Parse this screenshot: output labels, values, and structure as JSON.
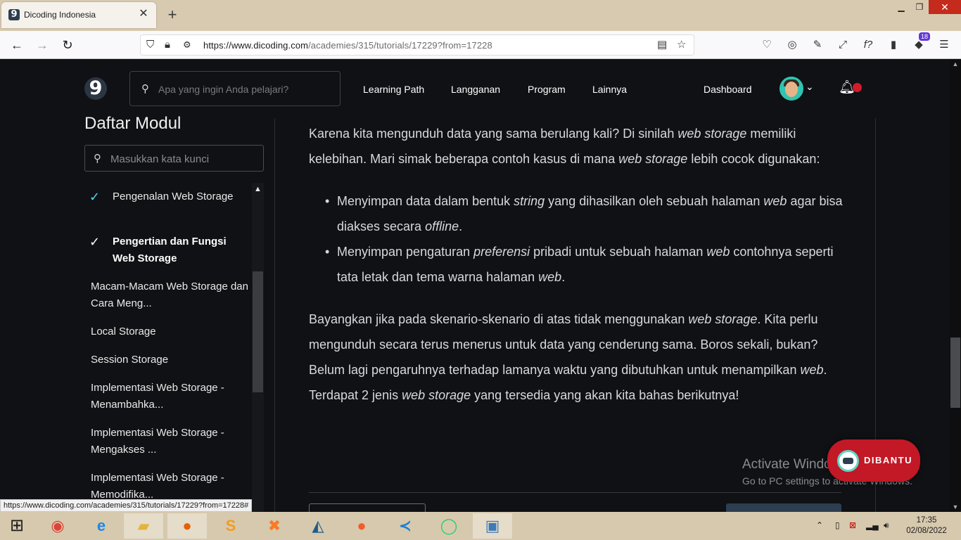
{
  "browser": {
    "tab_title": "Dicoding Indonesia",
    "tab_favicon": "9",
    "url_host": "https://www.dicoding.com",
    "url_path": "/academies/315/tutorials/17229?from=17228",
    "extension_badge": "18",
    "status_url": "https://www.dicoding.com/academies/315/tutorials/17229?from=17228#"
  },
  "header": {
    "logo_char": "9",
    "search_placeholder": "Apa yang ingin Anda pelajari?",
    "nav": [
      "Learning Path",
      "Langganan",
      "Program",
      "Lainnya"
    ],
    "dashboard": "Dashboard"
  },
  "sidebar": {
    "title": "Daftar Modul",
    "search_placeholder": "Masukkan kata kunci",
    "items": [
      {
        "label": "Pengenalan Web Storage",
        "state": "done"
      },
      {
        "label": "Pengertian dan Fungsi Web Storage",
        "state": "active"
      },
      {
        "label": "Macam-Macam Web Storage dan Cara Meng...",
        "state": "plain"
      },
      {
        "label": "Local Storage",
        "state": "plain"
      },
      {
        "label": "Session Storage",
        "state": "plain"
      },
      {
        "label": "Implementasi Web Storage - Menambahka...",
        "state": "plain"
      },
      {
        "label": "Implementasi Web Storage - Mengakses ...",
        "state": "plain"
      },
      {
        "label": "Implementasi Web Storage - Memodifika...",
        "state": "plain"
      }
    ]
  },
  "content": {
    "p1": [
      {
        "t": "Karena kita mengunduh data yang sama berulang kali? Di sinilah "
      },
      {
        "t": "web storage",
        "i": true
      },
      {
        "t": " memiliki kelebihan. Mari simak beberapa contoh kasus di mana "
      },
      {
        "t": "web storage",
        "i": true
      },
      {
        "t": " lebih cocok digunakan:"
      }
    ],
    "bullets": [
      [
        {
          "t": "Menyimpan data dalam bentuk "
        },
        {
          "t": "string",
          "i": true
        },
        {
          "t": " yang dihasilkan oleh sebuah halaman "
        },
        {
          "t": "web",
          "i": true
        },
        {
          "t": " agar bisa diakses secara "
        },
        {
          "t": "offline",
          "i": true
        },
        {
          "t": "."
        }
      ],
      [
        {
          "t": "Menyimpan pengaturan "
        },
        {
          "t": "preferensi",
          "i": true
        },
        {
          "t": " pribadi untuk sebuah halaman "
        },
        {
          "t": "web",
          "i": true
        },
        {
          "t": " contohnya seperti tata letak dan tema warna halaman "
        },
        {
          "t": "web",
          "i": true
        },
        {
          "t": "."
        }
      ]
    ],
    "p2": [
      {
        "t": "Bayangkan jika pada skenario-skenario di atas tidak menggunakan "
      },
      {
        "t": "web storage",
        "i": true
      },
      {
        "t": ". Kita perlu mengunduh secara terus menerus untuk data yang cenderung sama. Boros sekali, bukan? Belum lagi pengaruhnya terhadap lamanya waktu yang dibutuhkan untuk menampilkan "
      },
      {
        "t": "web",
        "i": true
      },
      {
        "t": ". Terdapat 2 jenis "
      },
      {
        "t": "web storage",
        "i": true
      },
      {
        "t": " yang tersedia yang akan kita bahas berikutnya!"
      }
    ]
  },
  "overlay": {
    "activate_title": "Activate Windows",
    "activate_sub": "Go to PC settings to activate Windows.",
    "dibantu": "DIBANTU"
  },
  "taskbar": {
    "time": "17:35",
    "date": "02/08/2022"
  },
  "colors": {
    "accent_check": "#4fd6e6",
    "notification_dot": "#d41b2c",
    "dibantu_red": "#c31826"
  }
}
